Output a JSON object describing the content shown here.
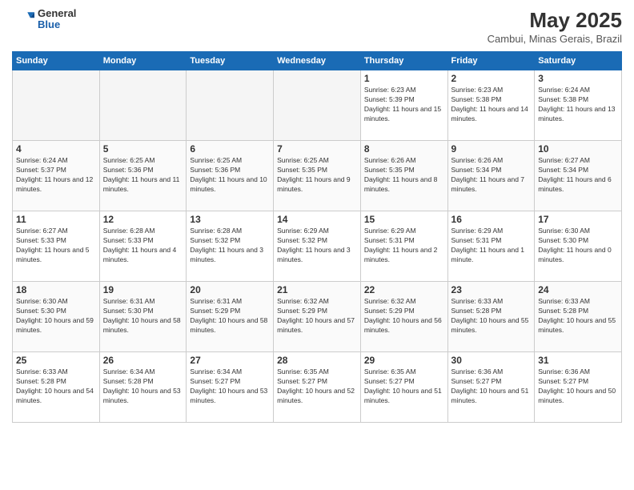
{
  "header": {
    "logo_general": "General",
    "logo_blue": "Blue",
    "month_year": "May 2025",
    "location": "Cambui, Minas Gerais, Brazil"
  },
  "days_of_week": [
    "Sunday",
    "Monday",
    "Tuesday",
    "Wednesday",
    "Thursday",
    "Friday",
    "Saturday"
  ],
  "weeks": [
    [
      {
        "day": "",
        "empty": true
      },
      {
        "day": "",
        "empty": true
      },
      {
        "day": "",
        "empty": true
      },
      {
        "day": "",
        "empty": true
      },
      {
        "day": "1",
        "sunrise": "6:23 AM",
        "sunset": "5:39 PM",
        "daylight": "11 hours and 15 minutes."
      },
      {
        "day": "2",
        "sunrise": "6:23 AM",
        "sunset": "5:38 PM",
        "daylight": "11 hours and 14 minutes."
      },
      {
        "day": "3",
        "sunrise": "6:24 AM",
        "sunset": "5:38 PM",
        "daylight": "11 hours and 13 minutes."
      }
    ],
    [
      {
        "day": "4",
        "sunrise": "6:24 AM",
        "sunset": "5:37 PM",
        "daylight": "11 hours and 12 minutes."
      },
      {
        "day": "5",
        "sunrise": "6:25 AM",
        "sunset": "5:36 PM",
        "daylight": "11 hours and 11 minutes."
      },
      {
        "day": "6",
        "sunrise": "6:25 AM",
        "sunset": "5:36 PM",
        "daylight": "11 hours and 10 minutes."
      },
      {
        "day": "7",
        "sunrise": "6:25 AM",
        "sunset": "5:35 PM",
        "daylight": "11 hours and 9 minutes."
      },
      {
        "day": "8",
        "sunrise": "6:26 AM",
        "sunset": "5:35 PM",
        "daylight": "11 hours and 8 minutes."
      },
      {
        "day": "9",
        "sunrise": "6:26 AM",
        "sunset": "5:34 PM",
        "daylight": "11 hours and 7 minutes."
      },
      {
        "day": "10",
        "sunrise": "6:27 AM",
        "sunset": "5:34 PM",
        "daylight": "11 hours and 6 minutes."
      }
    ],
    [
      {
        "day": "11",
        "sunrise": "6:27 AM",
        "sunset": "5:33 PM",
        "daylight": "11 hours and 5 minutes."
      },
      {
        "day": "12",
        "sunrise": "6:28 AM",
        "sunset": "5:33 PM",
        "daylight": "11 hours and 4 minutes."
      },
      {
        "day": "13",
        "sunrise": "6:28 AM",
        "sunset": "5:32 PM",
        "daylight": "11 hours and 3 minutes."
      },
      {
        "day": "14",
        "sunrise": "6:29 AM",
        "sunset": "5:32 PM",
        "daylight": "11 hours and 3 minutes."
      },
      {
        "day": "15",
        "sunrise": "6:29 AM",
        "sunset": "5:31 PM",
        "daylight": "11 hours and 2 minutes."
      },
      {
        "day": "16",
        "sunrise": "6:29 AM",
        "sunset": "5:31 PM",
        "daylight": "11 hours and 1 minute."
      },
      {
        "day": "17",
        "sunrise": "6:30 AM",
        "sunset": "5:30 PM",
        "daylight": "11 hours and 0 minutes."
      }
    ],
    [
      {
        "day": "18",
        "sunrise": "6:30 AM",
        "sunset": "5:30 PM",
        "daylight": "10 hours and 59 minutes."
      },
      {
        "day": "19",
        "sunrise": "6:31 AM",
        "sunset": "5:30 PM",
        "daylight": "10 hours and 58 minutes."
      },
      {
        "day": "20",
        "sunrise": "6:31 AM",
        "sunset": "5:29 PM",
        "daylight": "10 hours and 58 minutes."
      },
      {
        "day": "21",
        "sunrise": "6:32 AM",
        "sunset": "5:29 PM",
        "daylight": "10 hours and 57 minutes."
      },
      {
        "day": "22",
        "sunrise": "6:32 AM",
        "sunset": "5:29 PM",
        "daylight": "10 hours and 56 minutes."
      },
      {
        "day": "23",
        "sunrise": "6:33 AM",
        "sunset": "5:28 PM",
        "daylight": "10 hours and 55 minutes."
      },
      {
        "day": "24",
        "sunrise": "6:33 AM",
        "sunset": "5:28 PM",
        "daylight": "10 hours and 55 minutes."
      }
    ],
    [
      {
        "day": "25",
        "sunrise": "6:33 AM",
        "sunset": "5:28 PM",
        "daylight": "10 hours and 54 minutes."
      },
      {
        "day": "26",
        "sunrise": "6:34 AM",
        "sunset": "5:28 PM",
        "daylight": "10 hours and 53 minutes."
      },
      {
        "day": "27",
        "sunrise": "6:34 AM",
        "sunset": "5:27 PM",
        "daylight": "10 hours and 53 minutes."
      },
      {
        "day": "28",
        "sunrise": "6:35 AM",
        "sunset": "5:27 PM",
        "daylight": "10 hours and 52 minutes."
      },
      {
        "day": "29",
        "sunrise": "6:35 AM",
        "sunset": "5:27 PM",
        "daylight": "10 hours and 51 minutes."
      },
      {
        "day": "30",
        "sunrise": "6:36 AM",
        "sunset": "5:27 PM",
        "daylight": "10 hours and 51 minutes."
      },
      {
        "day": "31",
        "sunrise": "6:36 AM",
        "sunset": "5:27 PM",
        "daylight": "10 hours and 50 minutes."
      }
    ]
  ]
}
